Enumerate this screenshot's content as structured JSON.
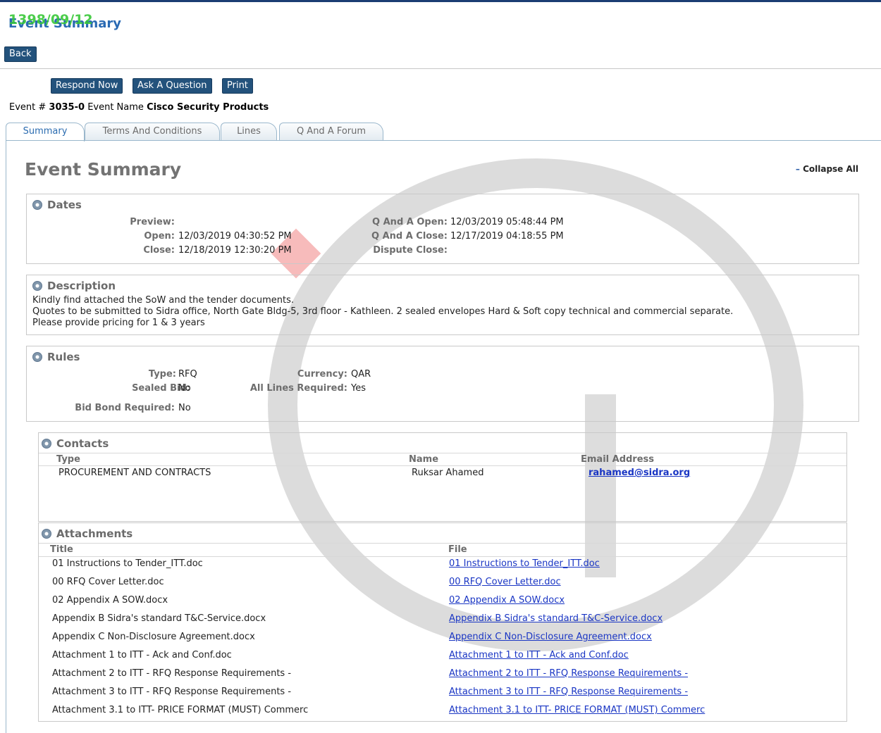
{
  "stamp": "1398/09/12",
  "page_title": "Event Summary",
  "back_label": "Back",
  "actions": {
    "respond": "Respond Now",
    "ask": "Ask A Question",
    "print": "Print"
  },
  "event": {
    "number_label": "Event #",
    "number": "3035-0",
    "name_label": "Event Name",
    "name": "Cisco Security Products"
  },
  "tabs": [
    "Summary",
    "Terms And Conditions",
    "Lines",
    "Q And A Forum"
  ],
  "summary_heading": "Event Summary",
  "collapse_label": "Collapse All",
  "dates": {
    "title": "Dates",
    "preview_label": "Preview:",
    "open_label": "Open:",
    "open": "12/03/2019 04:30:52 PM",
    "close_label": "Close:",
    "close": "12/18/2019 12:30:20 PM",
    "qa_open_label": "Q And A Open:",
    "qa_open": "12/03/2019 05:48:44 PM",
    "qa_close_label": "Q And A Close:",
    "qa_close": "12/17/2019 04:18:55 PM",
    "dispute_label": "Dispute Close:"
  },
  "description": {
    "title": "Description",
    "lines": [
      "Kindly find attached the SoW and the tender documents.",
      "Quotes to be submitted to Sidra office, North Gate Bldg-5, 3rd floor - Kathleen. 2 sealed envelopes Hard & Soft copy technical and commercial separate.",
      "Please provide pricing for 1 & 3 years"
    ]
  },
  "rules": {
    "title": "Rules",
    "type_label": "Type:",
    "type": "RFQ",
    "currency_label": "Currency:",
    "currency": "QAR",
    "sealed_label": "Sealed Bid:",
    "sealed": "No",
    "all_lines_label": "All Lines Required:",
    "all_lines": "Yes",
    "bond_label": "Bid Bond Required:",
    "bond": "No"
  },
  "contacts": {
    "title": "Contacts",
    "headers": {
      "type": "Type",
      "name": "Name",
      "email": "Email Address"
    },
    "rows": [
      {
        "type": "PROCUREMENT AND CONTRACTS",
        "name": "Ruksar Ahamed",
        "email": "rahamed@sidra.org"
      }
    ]
  },
  "attachments": {
    "title": "Attachments",
    "headers": {
      "title": "Title",
      "file": "File"
    },
    "rows": [
      {
        "title": "01 Instructions to Tender_ITT.doc",
        "file": "01 Instructions to Tender_ITT.doc"
      },
      {
        "title": "00 RFQ Cover Letter.doc",
        "file": "00 RFQ Cover Letter.doc"
      },
      {
        "title": "02 Appendix A SOW.docx",
        "file": "02 Appendix A SOW.docx"
      },
      {
        "title": "Appendix B Sidra's standard T&C-Service.docx",
        "file": "Appendix B Sidra's standard T&C-Service.docx"
      },
      {
        "title": "Appendix C Non-Disclosure Agreement.docx",
        "file": "Appendix C Non-Disclosure Agreement.docx"
      },
      {
        "title": "Attachment 1 to ITT - Ack and Conf.doc",
        "file": "Attachment 1 to ITT - Ack and Conf.doc"
      },
      {
        "title": "Attachment 2 to ITT - RFQ Response Requirements -",
        "file": "Attachment 2 to ITT - RFQ Response Requirements -"
      },
      {
        "title": "Attachment 3 to ITT - RFQ Response Requirements -",
        "file": "Attachment 3 to ITT - RFQ Response Requirements -"
      },
      {
        "title": "Attachment 3.1 to ITT- PRICE FORMAT (MUST) Commerc",
        "file": "Attachment 3.1 to ITT- PRICE FORMAT (MUST) Commerc"
      }
    ]
  },
  "watermark": {
    "primary": "#969696",
    "accent": "#f07878"
  },
  "colors": {
    "button": "#23527c",
    "link": "#1a36c4",
    "title": "#2a6ab3",
    "stamp": "#39c839"
  }
}
